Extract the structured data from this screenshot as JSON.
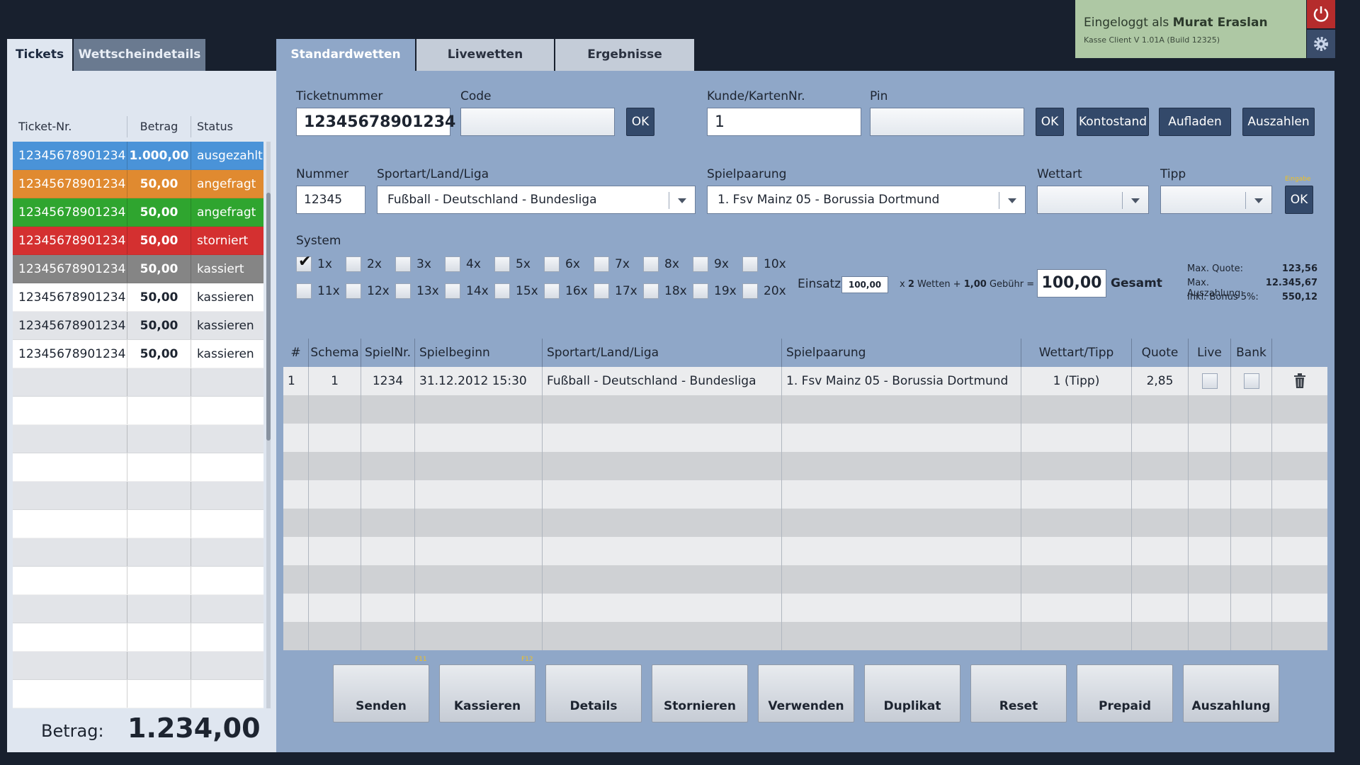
{
  "user": {
    "prefix": "Eingeloggt als",
    "name": "Murat Eraslan",
    "version": "Kasse Client V 1.01A (Build 12325)"
  },
  "left_tabs": [
    "Tickets",
    "Wettscheindetails"
  ],
  "right_tabs": [
    "Standardwetten",
    "Livewetten",
    "Ergebnisse"
  ],
  "ticket_list": {
    "headers": [
      "Ticket-Nr.",
      "Betrag",
      "Status"
    ],
    "rows": [
      {
        "nr": "12345678901234",
        "betrag": "1.000,00",
        "status": "ausgezahlt",
        "color": "#4a93d8"
      },
      {
        "nr": "12345678901234",
        "betrag": "50,00",
        "status": "angefragt",
        "color": "#e08a30"
      },
      {
        "nr": "12345678901234",
        "betrag": "50,00",
        "status": "angefragt",
        "color": "#2fa52f"
      },
      {
        "nr": "12345678901234",
        "betrag": "50,00",
        "status": "storniert",
        "color": "#d43030"
      },
      {
        "nr": "12345678901234",
        "betrag": "50,00",
        "status": "kassiert",
        "color": "#858585"
      },
      {
        "nr": "12345678901234",
        "betrag": "50,00",
        "status": "kassieren"
      },
      {
        "nr": "12345678901234",
        "betrag": "50,00",
        "status": "kassieren"
      },
      {
        "nr": "12345678901234",
        "betrag": "50,00",
        "status": "kassieren"
      }
    ]
  },
  "betrag": {
    "label": "Betrag:",
    "value": "1.234,00"
  },
  "form": {
    "ticketnummer_label": "Ticketnummer",
    "ticketnummer_value": "12345678901234",
    "code_label": "Code",
    "code_value": "",
    "ok": "OK",
    "kunde_label": "Kunde/KartenNr.",
    "kunde_value": "1",
    "pin_label": "Pin",
    "pin_value": "",
    "kontostand": "Kontostand",
    "aufladen": "Aufladen",
    "auszahlen": "Auszahlen",
    "nummer_label": "Nummer",
    "nummer_value": "12345",
    "sportart_label": "Sportart/Land/Liga",
    "sportart_value": "Fußball - Deutschland - Bundesliga",
    "spielpaarung_label": "Spielpaarung",
    "spielpaarung_value": "1. Fsv Mainz 05 - Borussia Dortmund",
    "wettart_label": "Wettart",
    "wettart_value": "",
    "tipp_label": "Tipp",
    "tipp_value": "",
    "eingabe": "Eingabe"
  },
  "system": {
    "label": "System",
    "options": [
      "1x",
      "2x",
      "3x",
      "4x",
      "5x",
      "6x",
      "7x",
      "8x",
      "9x",
      "10x",
      "11x",
      "12x",
      "13x",
      "14x",
      "15x",
      "16x",
      "17x",
      "18x",
      "19x",
      "20x"
    ],
    "checked": [
      "1x"
    ]
  },
  "einsatz": {
    "label": "Einsatz",
    "value": "100,00",
    "formula_x": "x",
    "wetten_count": "2",
    "wetten_label": "Wetten +",
    "gebuehr": "1,00",
    "gebuehr_label": "Gebühr =",
    "gesamt_value": "100,00",
    "gesamt_label": "Gesamt"
  },
  "stats": [
    {
      "label": "Max. Quote:",
      "value": "123,56"
    },
    {
      "label": "Max. Auszahlung:",
      "value": "12.345,67"
    },
    {
      "label": "Inkl. Bonus 5%:",
      "value": "550,12"
    }
  ],
  "bets_table": {
    "headers": [
      "#",
      "Schema",
      "SpielNr.",
      "Spielbeginn",
      "Sportart/Land/Liga",
      "Spielpaarung",
      "Wettart/Tipp",
      "Quote",
      "Live",
      "Bank"
    ],
    "rows": [
      {
        "idx": "1",
        "schema": "1",
        "spielnr": "1234",
        "beginn": "31.12.2012  15:30",
        "sportart": "Fußball - Deutschland - Bundesliga",
        "paarung": "1. Fsv Mainz 05 - Borussia Dortmund",
        "tipp": "1 (Tipp)",
        "quote": "2,85"
      }
    ]
  },
  "actions": [
    "Senden",
    "Kassieren",
    "Details",
    "Stornieren",
    "Verwenden",
    "Duplikat",
    "Reset",
    "Prepaid",
    "Auszahlung"
  ],
  "fkeys": {
    "senden": "F11",
    "kassieren": "F12"
  }
}
